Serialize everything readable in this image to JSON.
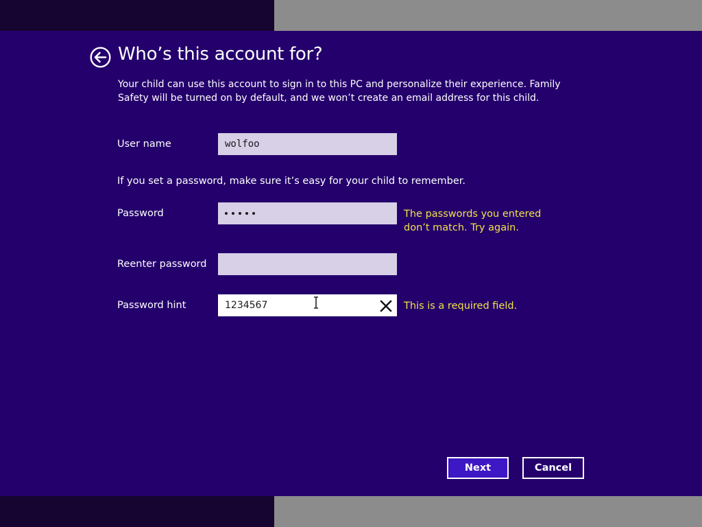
{
  "header": {
    "title": "Who’s this account for?",
    "description": "Your child can use this account to sign in to this PC and personalize their experience. Family Safety will be turned on by default, and we won’t create an email address for this child."
  },
  "form": {
    "username_label": "User name",
    "username_value": "wolfoo",
    "password_note": "If you set a password, make sure it’s easy for your child to remember.",
    "password_label": "Password",
    "password_masked_length": 5,
    "password_error": "The passwords you entered don’t match. Try again.",
    "reenter_label": "Reenter password",
    "reenter_value": "",
    "hint_label": "Password hint",
    "hint_value": "1234567",
    "hint_error": "This is a required field."
  },
  "buttons": {
    "next": "Next",
    "cancel": "Cancel"
  },
  "colors": {
    "dialog_background": "#24006c",
    "error_text": "#f2e24a",
    "primary_button": "#3e18c4"
  },
  "icons": {
    "back": "back-arrow-circle-icon",
    "clear": "close-icon",
    "cursor": "text-cursor-icon"
  }
}
